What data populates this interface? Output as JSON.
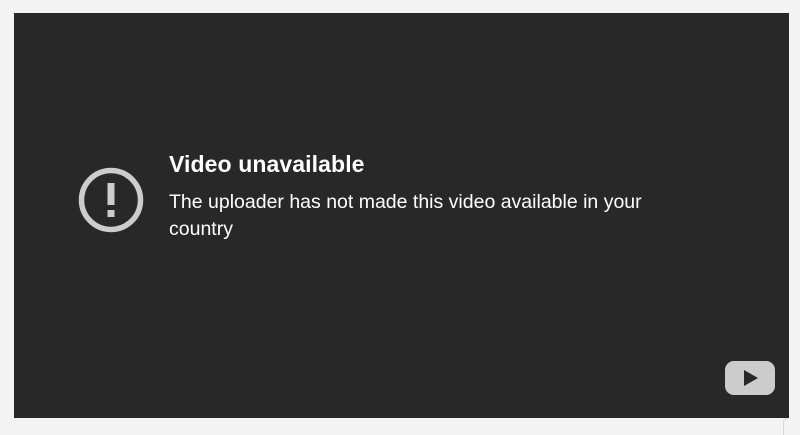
{
  "player": {
    "background_color": "#282828",
    "error": {
      "icon": "exclamation-circle-icon",
      "icon_color": "#cccccc",
      "title": "Video unavailable",
      "message": "The uploader has not made this video available in your country"
    },
    "logo": {
      "icon": "youtube-logo-icon",
      "color": "#cccccc"
    }
  }
}
